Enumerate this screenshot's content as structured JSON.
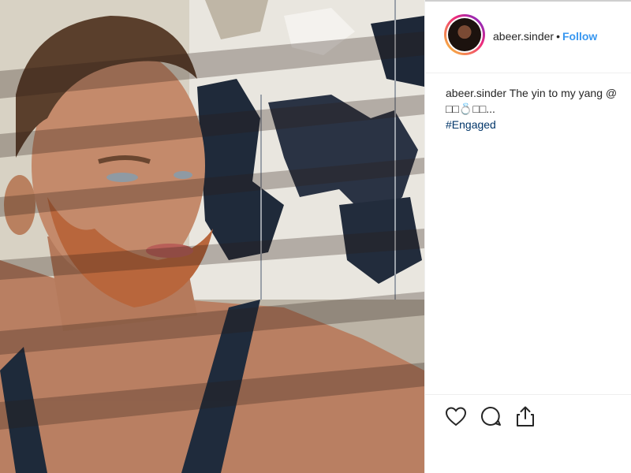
{
  "post": {
    "username": "abeer.sinder",
    "separator": "•",
    "follow_label": "Follow",
    "caption": {
      "user": "abeer.sinder",
      "text": "The yin to my yang @",
      "emoji_line": "□□💍□□...",
      "hashtag": "#Engaged"
    }
  },
  "actions": {
    "like_icon": "heart-icon",
    "comment_icon": "comment-icon",
    "share_icon": "share-icon"
  },
  "colors": {
    "follow": "#3897f0",
    "hashtag": "#003569",
    "text": "#262626"
  }
}
